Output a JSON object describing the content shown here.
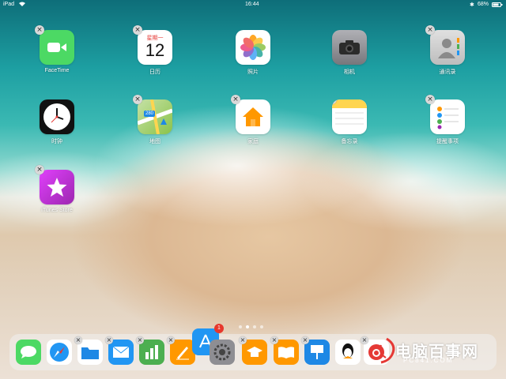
{
  "status_bar": {
    "device": "iPad",
    "wifi_icon": "wifi-icon",
    "time": "16:44",
    "battery": "68%"
  },
  "apps": [
    {
      "label": "FaceTime",
      "icon": "facetime-icon",
      "color": "#4cd964"
    },
    {
      "label": "日历",
      "icon": "calendar-icon",
      "color": "#ffffff",
      "weekday": "星期一",
      "day": "12"
    },
    {
      "label": "照片",
      "icon": "photos-icon",
      "color": "#ffffff"
    },
    {
      "label": "相机",
      "icon": "camera-icon",
      "color": "#8e8e93"
    },
    {
      "label": "通讯录",
      "icon": "contacts-icon",
      "color": "#d9d9d9"
    },
    {
      "label": "时钟",
      "icon": "clock-icon",
      "color": "#111111"
    },
    {
      "label": "地图",
      "icon": "maps-icon",
      "color": "#8bc34a",
      "badge_text": "280"
    },
    {
      "label": "家庭",
      "icon": "home-icon",
      "color": "#ffffff"
    },
    {
      "label": "备忘录",
      "icon": "notes-icon",
      "color": "#ffd54f"
    },
    {
      "label": "提醒事项",
      "icon": "reminders-icon",
      "color": "#ffffff"
    },
    {
      "label": "iTunes Store",
      "icon": "itunes-star-icon",
      "color": "#c542e0"
    }
  ],
  "page_dots": {
    "count": 4,
    "active_index": 1
  },
  "dock": {
    "apps": [
      {
        "icon": "messages-icon",
        "color": "#4cd964"
      },
      {
        "icon": "safari-icon",
        "color": "#ffffff"
      },
      {
        "icon": "files-icon",
        "color": "#1e88e5"
      },
      {
        "icon": "mail-icon",
        "color": "#2196f3"
      },
      {
        "icon": "numbers-icon",
        "color": "#4caf50"
      },
      {
        "icon": "pages-icon",
        "color": "#ff9800"
      },
      {
        "icon": "appstore-icon",
        "color": "#2196f3",
        "badge": "1"
      },
      {
        "icon": "settings-icon",
        "color": "#8e8e93"
      },
      {
        "icon": "itunes-u-icon",
        "color": "#ff9800"
      },
      {
        "icon": "ibooks-icon",
        "color": "#ff9800"
      },
      {
        "icon": "keynote-icon",
        "color": "#1e88e5"
      },
      {
        "icon": "qq-icon",
        "color": "#ffffff"
      },
      {
        "icon": "netease-music-icon",
        "color": "#e53935"
      }
    ]
  },
  "watermark": {
    "text": "电脑百事网",
    "sub": "PC841.COM"
  }
}
